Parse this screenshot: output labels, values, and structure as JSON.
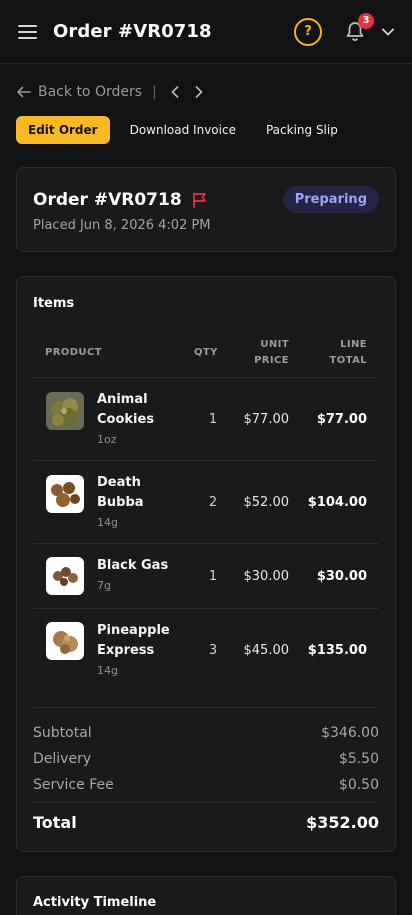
{
  "header": {
    "title": "Order #VR0718",
    "menu_icon": "hamburger-icon",
    "help_icon": "question-circle-icon",
    "bell_icon": "bell-icon",
    "notification_count": "3",
    "menu_chevron_icon": "chevron-down-icon",
    "accent_color": "#f2b51a",
    "badge_color": "#e5333f"
  },
  "nav": {
    "back_label": "Back to Orders",
    "separator": "|",
    "prev_icon": "chevron-left-icon",
    "next_icon": "chevron-right-icon"
  },
  "actions": {
    "edit_label": "Edit Order",
    "invoice_label": "Download Invoice",
    "packing_label": "Packing Slip"
  },
  "order": {
    "title": "Order #VR0718",
    "flag_icon": "flag-icon",
    "placed": "Placed Jun 8, 2026 4:02 PM",
    "status": "Preparing"
  },
  "items": {
    "heading": "Items",
    "columns": {
      "product": "PRODUCT",
      "qty": "QTY",
      "unit_price": "UNIT PRICE",
      "line_total": "LINE TOTAL"
    },
    "rows": [
      {
        "name": "Animal Cookies",
        "size": "1oz",
        "qty": "1",
        "unit_price": "$77.00",
        "line_total": "$77.00"
      },
      {
        "name": "Death Bubba",
        "size": "14g",
        "qty": "2",
        "unit_price": "$52.00",
        "line_total": "$104.00"
      },
      {
        "name": "Black Gas",
        "size": "7g",
        "qty": "1",
        "unit_price": "$30.00",
        "line_total": "$30.00"
      },
      {
        "name": "Pineapple Express",
        "size": "14g",
        "qty": "3",
        "unit_price": "$45.00",
        "line_total": "$135.00"
      }
    ]
  },
  "totals": {
    "subtotal_label": "Subtotal",
    "subtotal": "$346.00",
    "delivery_label": "Delivery",
    "delivery": "$5.50",
    "fee_label": "Service Fee",
    "fee": "$0.50",
    "total_label": "Total",
    "total": "$352.00"
  },
  "timeline": {
    "heading": "Activity Timeline"
  }
}
